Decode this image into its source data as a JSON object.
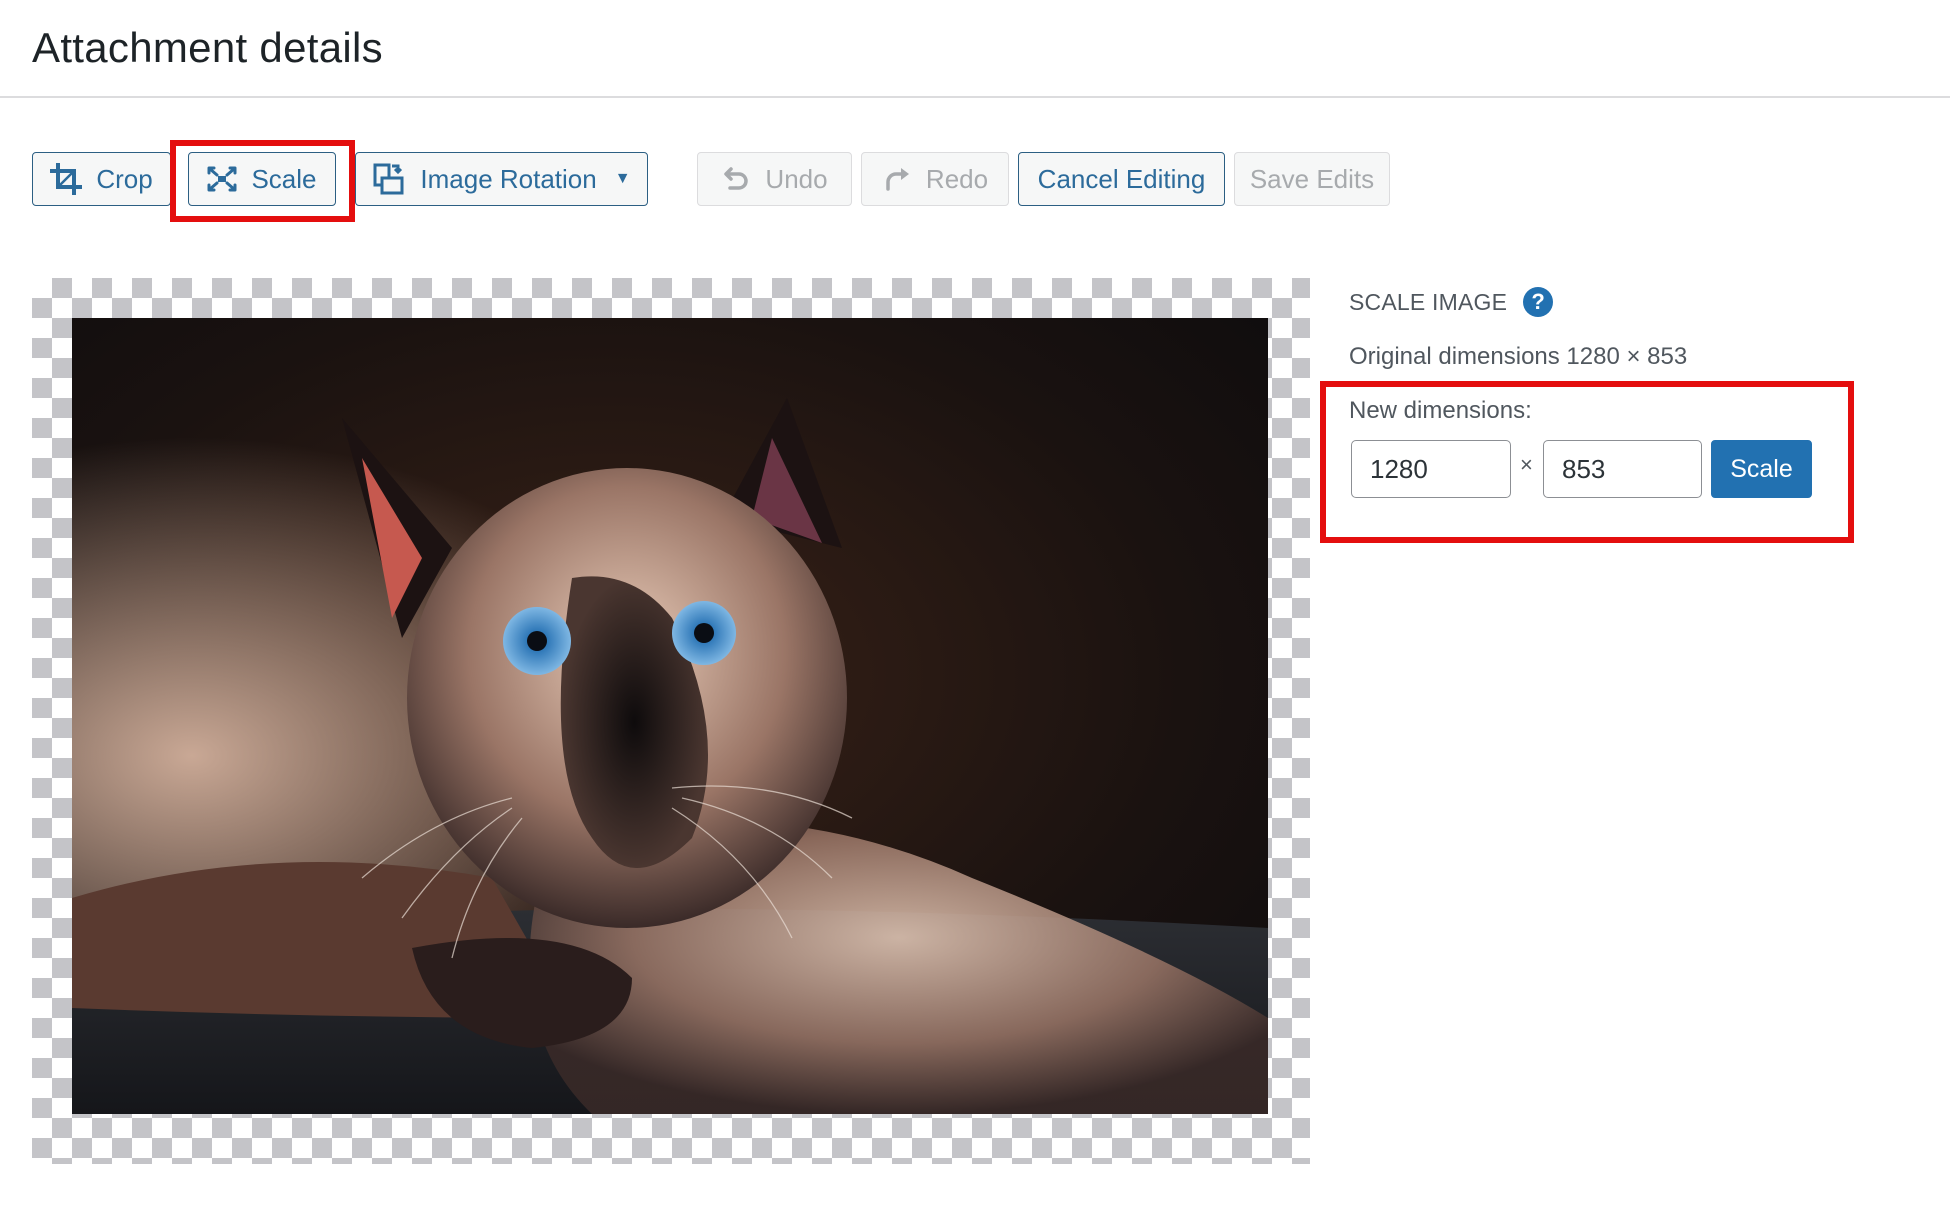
{
  "page": {
    "title": "Attachment details"
  },
  "toolbar": {
    "crop": {
      "label": "Crop",
      "icon": "crop-icon"
    },
    "scale": {
      "label": "Scale",
      "icon": "scale-icon",
      "highlighted": true
    },
    "rotation": {
      "label": "Image Rotation",
      "icon": "rotate-icon",
      "dropdown_icon": "caret-down-icon"
    },
    "undo": {
      "label": "Undo",
      "icon": "undo-icon",
      "disabled": true
    },
    "redo": {
      "label": "Redo",
      "icon": "redo-icon",
      "disabled": true
    },
    "cancel": {
      "label": "Cancel Editing"
    },
    "save": {
      "label": "Save Edits",
      "disabled": true
    }
  },
  "image": {
    "alt": "Siamese cat with blue eyes lying on a dark couch"
  },
  "scale_panel": {
    "heading": "SCALE IMAGE",
    "help_icon": "?",
    "original_label": "Original dimensions 1280 × 853",
    "new_label": "New dimensions:",
    "width_value": "1280",
    "height_value": "853",
    "separator": "×",
    "scale_button": "Scale"
  },
  "colors": {
    "accent": "#2271b1",
    "highlight": "#e40e0e",
    "button_text": "#2c6b9b"
  }
}
